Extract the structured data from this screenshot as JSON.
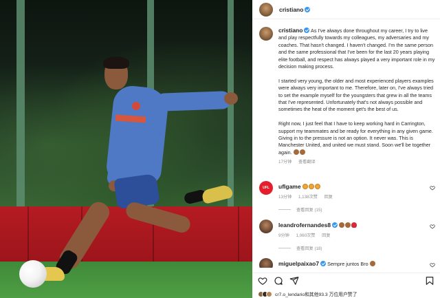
{
  "post": {
    "username": "cristiano",
    "verified": true
  },
  "caption": {
    "username": "cristiano",
    "paragraphs": [
      "As I've always done throughout my career, I try to live and play respectfully towards my colleagues, my adversaries and my coaches. That hasn't changed. I haven't changed. I'm the same person and the same professional that I've been for the last 20 years playing elite football, and respect has always played a very important role in my decision making process.",
      "I started very young, the older and most experienced players examples were always very important to me. Therefore, later on, I've always tried to set the example myself for the youngsters that grew in all the teams that I've represented. Unfortunately that's not always possible and sometimes the heat of the moment get's the best of us.",
      "Right now, I just feel that I have to keep working hard in Carrington, support my teammates and be ready for everything in any given game. Giving in to the pressure is not an option. It never was. This is Manchester United, and united we must stand. Soon we'll be together again."
    ],
    "time": "17分钟",
    "translate": "查看翻译"
  },
  "comments": [
    {
      "username": "uflgame",
      "avatar_label": "UFL",
      "text": "",
      "emojis": [
        "fire",
        "fire",
        "fire"
      ],
      "time": "13分钟",
      "likes": "1,138次赞",
      "reply": "回复",
      "view_replies": "查看回复 (15)"
    },
    {
      "username": "leandrofernandes8",
      "verified": true,
      "text": "",
      "emojis": [
        "muscle",
        "muscle",
        "heart"
      ],
      "time": "9分钟",
      "likes": "1,060次赞",
      "reply": "回复",
      "view_replies": "查看回复 (18)"
    },
    {
      "username": "miguelpaixao7",
      "verified": true,
      "text": "Sempre juntos Bro",
      "emojis": [
        "muscle"
      ]
    }
  ],
  "footer": {
    "liked_by": "cr7.o_lendario和其他93.3 万位用户赞了"
  },
  "icons": {
    "like": "heart-outline-icon",
    "comment": "comment-bubble-icon",
    "share": "paper-plane-icon",
    "save": "bookmark-icon"
  },
  "colors": {
    "verified_blue": "#3897f0",
    "hoarding_red": "#b51b22",
    "jersey_blue": "#4f79c4"
  }
}
